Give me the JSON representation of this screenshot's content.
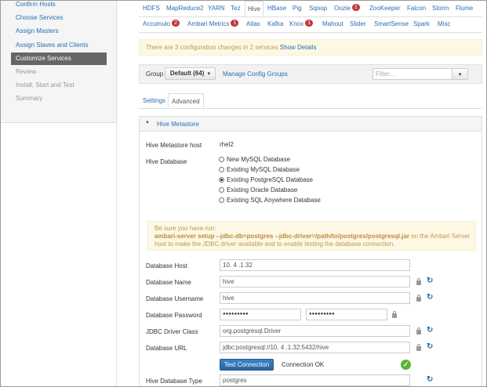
{
  "sidebar": {
    "items": [
      {
        "label": "Confirm Hosts",
        "state": "link"
      },
      {
        "label": "Choose Services",
        "state": "link"
      },
      {
        "label": "Assign Masters",
        "state": "link"
      },
      {
        "label": "Assign Slaves and Clients",
        "state": "link"
      },
      {
        "label": "Customize Services",
        "state": "active"
      },
      {
        "label": "Review",
        "state": "muted"
      },
      {
        "label": "Install, Start and Test",
        "state": "muted"
      },
      {
        "label": "Summary",
        "state": "muted"
      }
    ]
  },
  "service_tabs": {
    "row1": [
      {
        "label": "HDFS"
      },
      {
        "label": "MapReduce2"
      },
      {
        "label": "YARN"
      },
      {
        "label": "Tez"
      },
      {
        "label": "Hive",
        "active": true
      },
      {
        "label": "HBase"
      },
      {
        "label": "Pig"
      },
      {
        "label": "Sqoop"
      },
      {
        "label": "Oozie",
        "badge": "1"
      },
      {
        "label": "ZooKeeper"
      },
      {
        "label": "Falcon"
      },
      {
        "label": "Storm"
      },
      {
        "label": "Flume"
      }
    ],
    "row2": [
      {
        "label": "Accumulo",
        "badge": "2"
      },
      {
        "label": "Ambari Metrics",
        "badge": "1"
      },
      {
        "label": "Atlas"
      },
      {
        "label": "Kafka"
      },
      {
        "label": "Knox",
        "badge": "1"
      },
      {
        "label": "Mahout"
      },
      {
        "label": "Slider"
      },
      {
        "label": "SmartSense"
      },
      {
        "label": "Spark"
      },
      {
        "label": "Misc"
      }
    ]
  },
  "alert": {
    "text": "There are 3 configuration changes in 2 services",
    "link": "Show Details"
  },
  "group": {
    "label": "Group",
    "selected": "Default (64)",
    "manage": "Manage Config Groups",
    "filter_placeholder": "Filter..."
  },
  "subtabs": {
    "settings": "Settings",
    "advanced": "Advanced"
  },
  "section": {
    "title": "Hive Metastore"
  },
  "metastore_host": {
    "label": "Hive Metastore host",
    "value": "rhel2"
  },
  "hive_database": {
    "label": "Hive Database",
    "options": [
      {
        "label": "New MySQL Database",
        "selected": false
      },
      {
        "label": "Existing MySQL Database",
        "selected": false
      },
      {
        "label": "Existing PostgreSQL Database",
        "selected": true
      },
      {
        "label": "Existing Oracle Database",
        "selected": false
      },
      {
        "label": "Existing SQL Anywhere Database",
        "selected": false
      }
    ]
  },
  "note": {
    "line1": "Be sure you have run:",
    "command": "ambari-server setup --jdbc-db=postgres --jdbc-driver=/path/to/postgres/postgresql.jar",
    "line2": " on the Ambari Server",
    "line3": "host to make the JDBC driver available and to enable testing the database connection."
  },
  "fields": {
    "db_host": {
      "label": "Database Host",
      "value": "10. 4 .1.32"
    },
    "db_name": {
      "label": "Database Name",
      "value": "hive"
    },
    "db_user": {
      "label": "Database Username",
      "value": "hive"
    },
    "db_password": {
      "label": "Database Password",
      "value": "●●●●●●●●●",
      "confirm": "●●●●●●●●●"
    },
    "jdbc_class": {
      "label": "JDBC Driver Class",
      "value": "org.postgresql.Driver"
    },
    "db_url": {
      "label": "Database URL",
      "value": "jdbc:postgresql://10. 4 .1.32:5432/hive"
    },
    "db_type": {
      "label": "Hive Database Type",
      "value": "postgres"
    }
  },
  "test": {
    "button": "Test Connection",
    "status": "Connection OK"
  },
  "colors": {
    "accent": "#2a6db0",
    "active_nav": "#666666",
    "badge": "#c2373d",
    "success": "#5ab43a",
    "warning_bg": "#fcf8e3"
  },
  "icons": {
    "dropdown": "caret-down-icon",
    "lock": "lock-icon",
    "refresh": "refresh-icon",
    "ok": "check-circle-icon",
    "collapse": "caret-down-icon"
  }
}
